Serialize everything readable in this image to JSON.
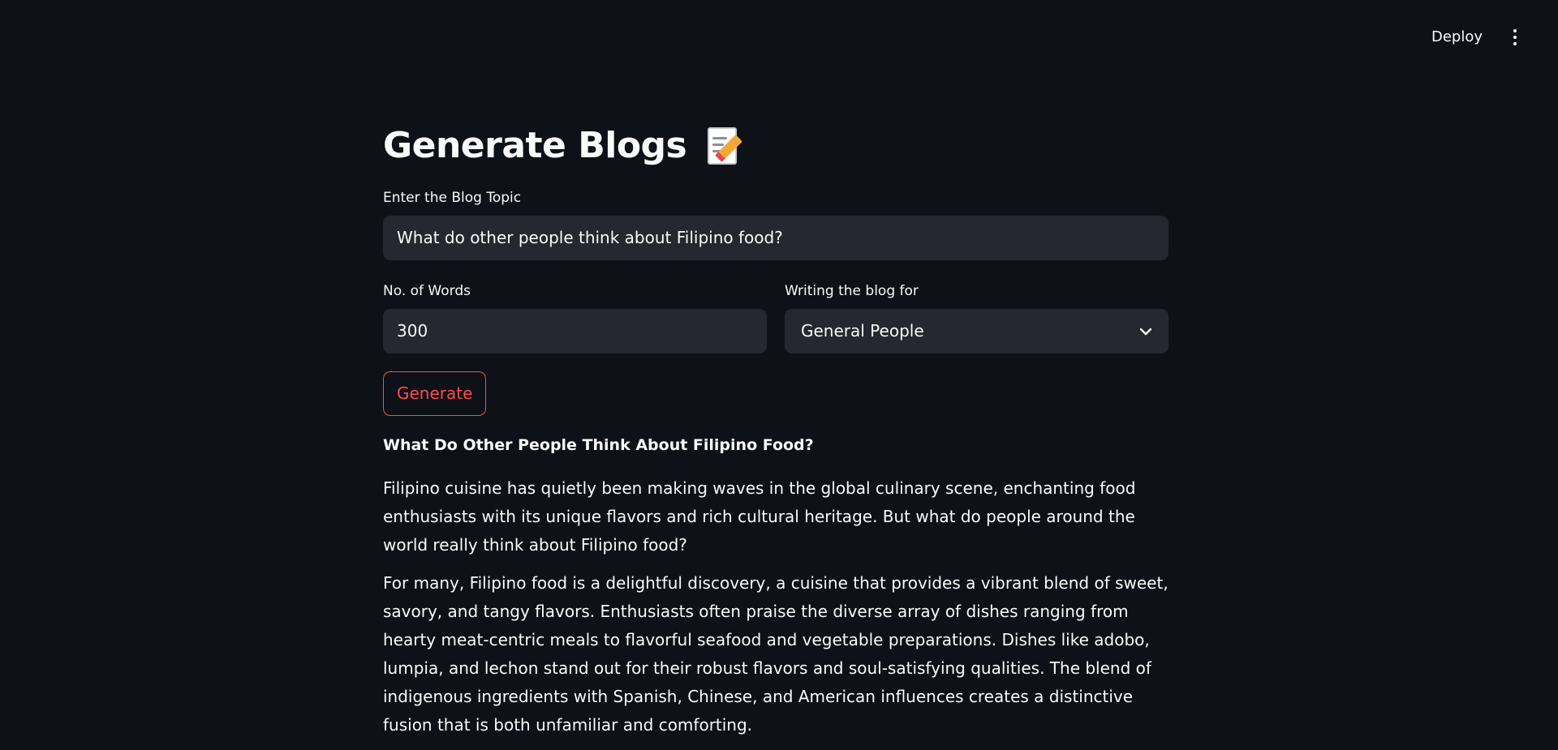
{
  "header": {
    "deploy_label": "Deploy",
    "menu_icon": "kebab-menu-icon"
  },
  "page": {
    "title": "Generate Blogs",
    "title_icon": "memo-icon"
  },
  "form": {
    "topic_label": "Enter the Blog Topic",
    "topic_value": "What do other people think about Filipino food?",
    "words_label": "No. of Words",
    "words_value": "300",
    "audience_label": "Writing the blog for",
    "audience_value": "General People",
    "generate_label": "Generate"
  },
  "article": {
    "heading": "What Do Other People Think About Filipino Food?",
    "paragraphs": [
      "Filipino cuisine has quietly been making waves in the global culinary scene, enchanting food enthusiasts with its unique flavors and rich cultural heritage. But what do people around the world really think about Filipino food?",
      "For many, Filipino food is a delightful discovery, a cuisine that provides a vibrant blend of sweet, savory, and tangy flavors. Enthusiasts often praise the diverse array of dishes ranging from hearty meat-centric meals to flavorful seafood and vegetable preparations. Dishes like adobo, lumpia, and lechon stand out for their robust flavors and soul-satisfying qualities. The blend of indigenous ingredients with Spanish, Chinese, and American influences creates a distinctive fusion that is both unfamiliar and comforting."
    ]
  },
  "colors": {
    "background": "#0e1117",
    "input_bg": "#262730",
    "accent": "#ff4b4b",
    "text": "#fafafa"
  }
}
